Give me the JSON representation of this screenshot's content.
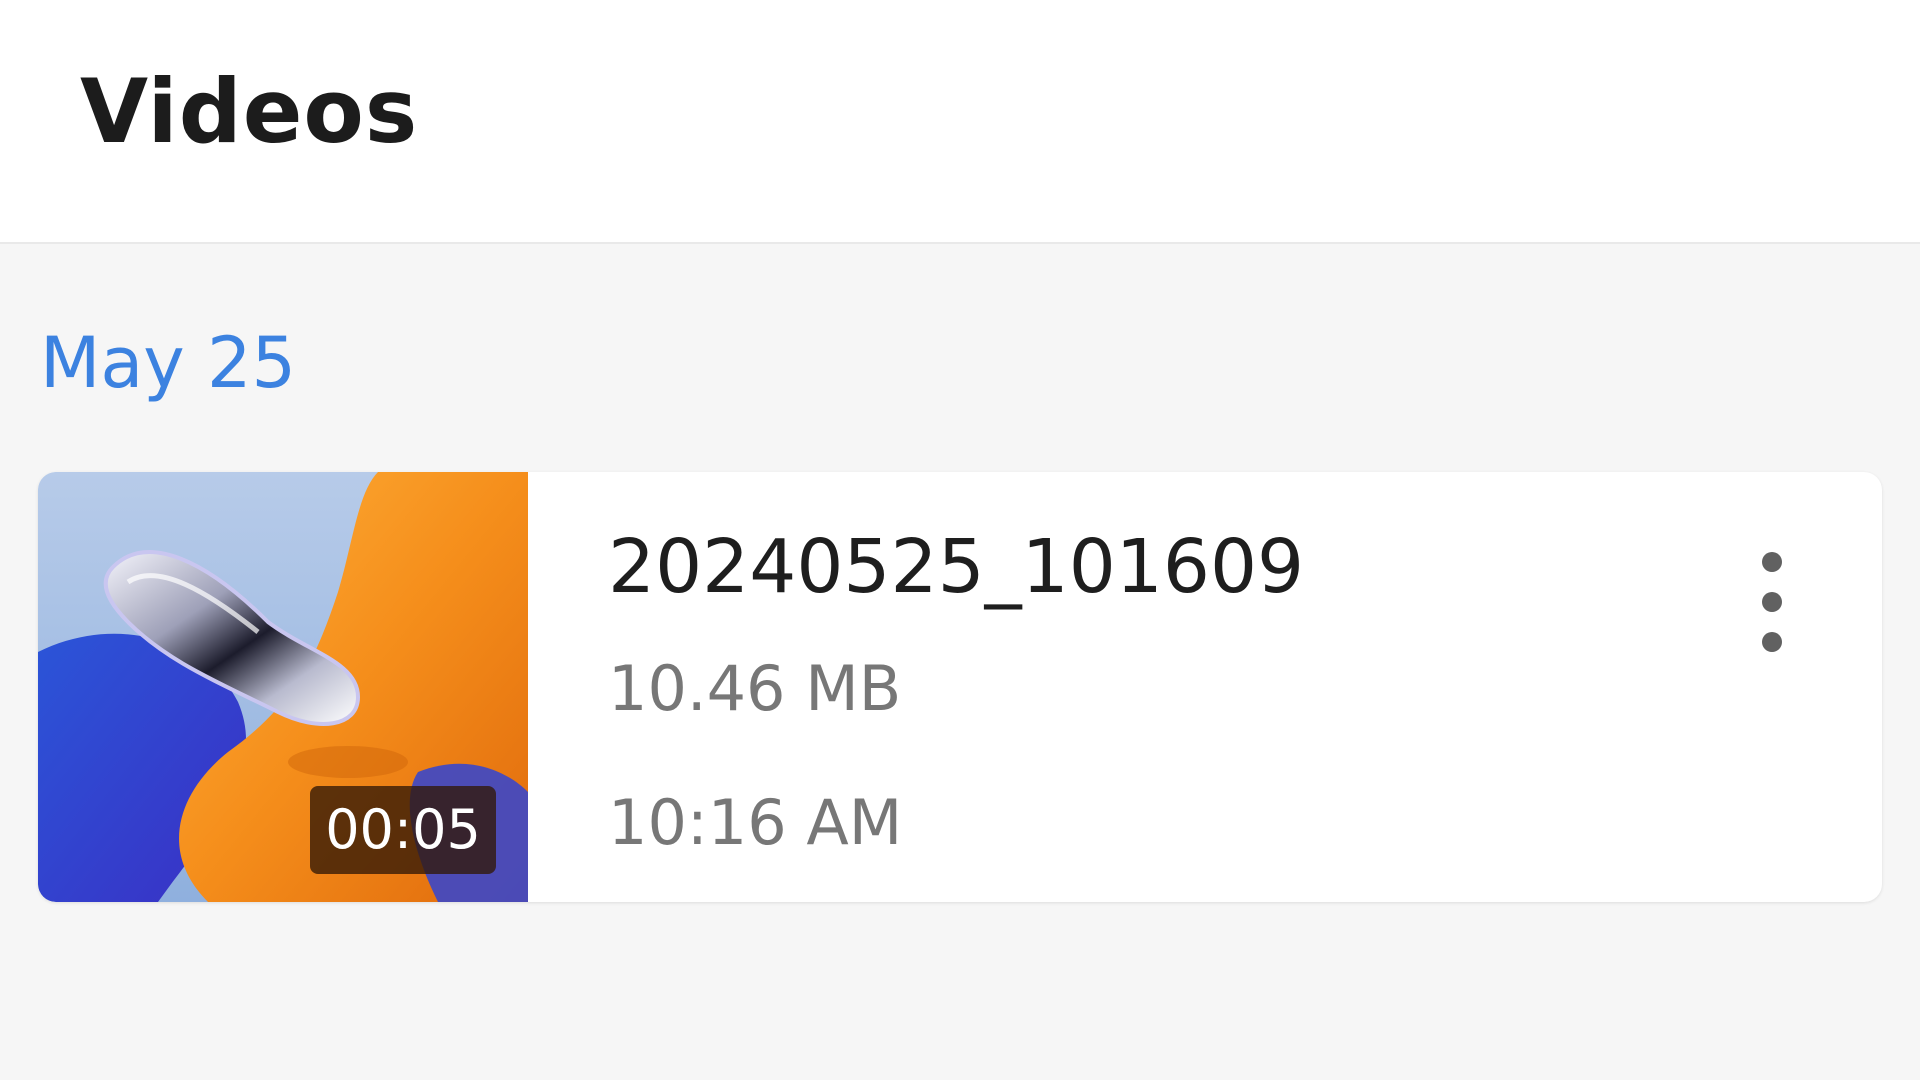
{
  "header": {
    "title": "Videos"
  },
  "section": {
    "date": "May 25"
  },
  "videos": [
    {
      "name": "20240525_101609",
      "size": "10.46 MB",
      "time": "10:16 AM",
      "duration": "00:05",
      "more_icon": "more-vert-icon"
    }
  ],
  "colors": {
    "accent": "#3c82e0",
    "title_text": "#1c1c1c",
    "secondary_text": "#777777",
    "background": "#f6f6f6",
    "card": "#ffffff"
  }
}
